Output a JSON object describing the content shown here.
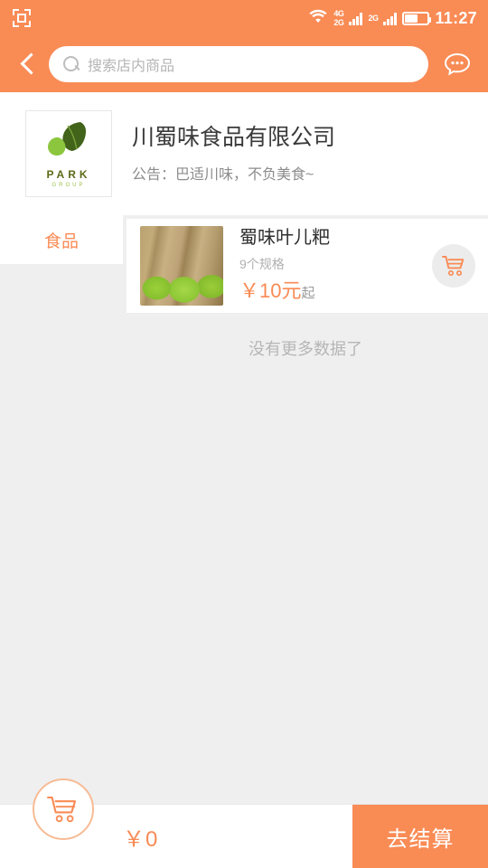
{
  "statusbar": {
    "capture_icon": "screenshot-capture-icon",
    "wifi_icon": "wifi-icon",
    "sim1_label_top": "4G",
    "sim1_label_bottom": "2G",
    "sim2_label": "2G",
    "battery_icon": "battery-icon",
    "time": "11:27"
  },
  "header": {
    "back_icon": "chevron-left-icon",
    "search_icon": "search-icon",
    "search_value": "",
    "search_placeholder": "搜索店内商品",
    "chat_icon": "chat-bubble-icon"
  },
  "store": {
    "logo_text": "PARK",
    "logo_subtext": "GROUP",
    "logo_icon": "leaf-logo-icon",
    "name": "川蜀味食品有限公司",
    "notice": "公告：巴适川味，不负美食~"
  },
  "categories": [
    {
      "label": "食品",
      "active": true
    }
  ],
  "products": [
    {
      "name": "蜀味叶儿粑",
      "spec": "9个规格",
      "price": "￥10元",
      "price_suffix": "起",
      "thumb_alt": "叶儿粑商品图片",
      "add_icon": "shopping-cart-icon"
    }
  ],
  "list_footer": "没有更多数据了",
  "bottombar": {
    "cart_icon": "shopping-cart-icon",
    "total": "￥0",
    "checkout_label": "去结算"
  },
  "colors": {
    "accent": "#f98b55",
    "page_bg": "#efefef",
    "card_bg": "#ffffff",
    "muted_text": "#b0b0b0"
  }
}
